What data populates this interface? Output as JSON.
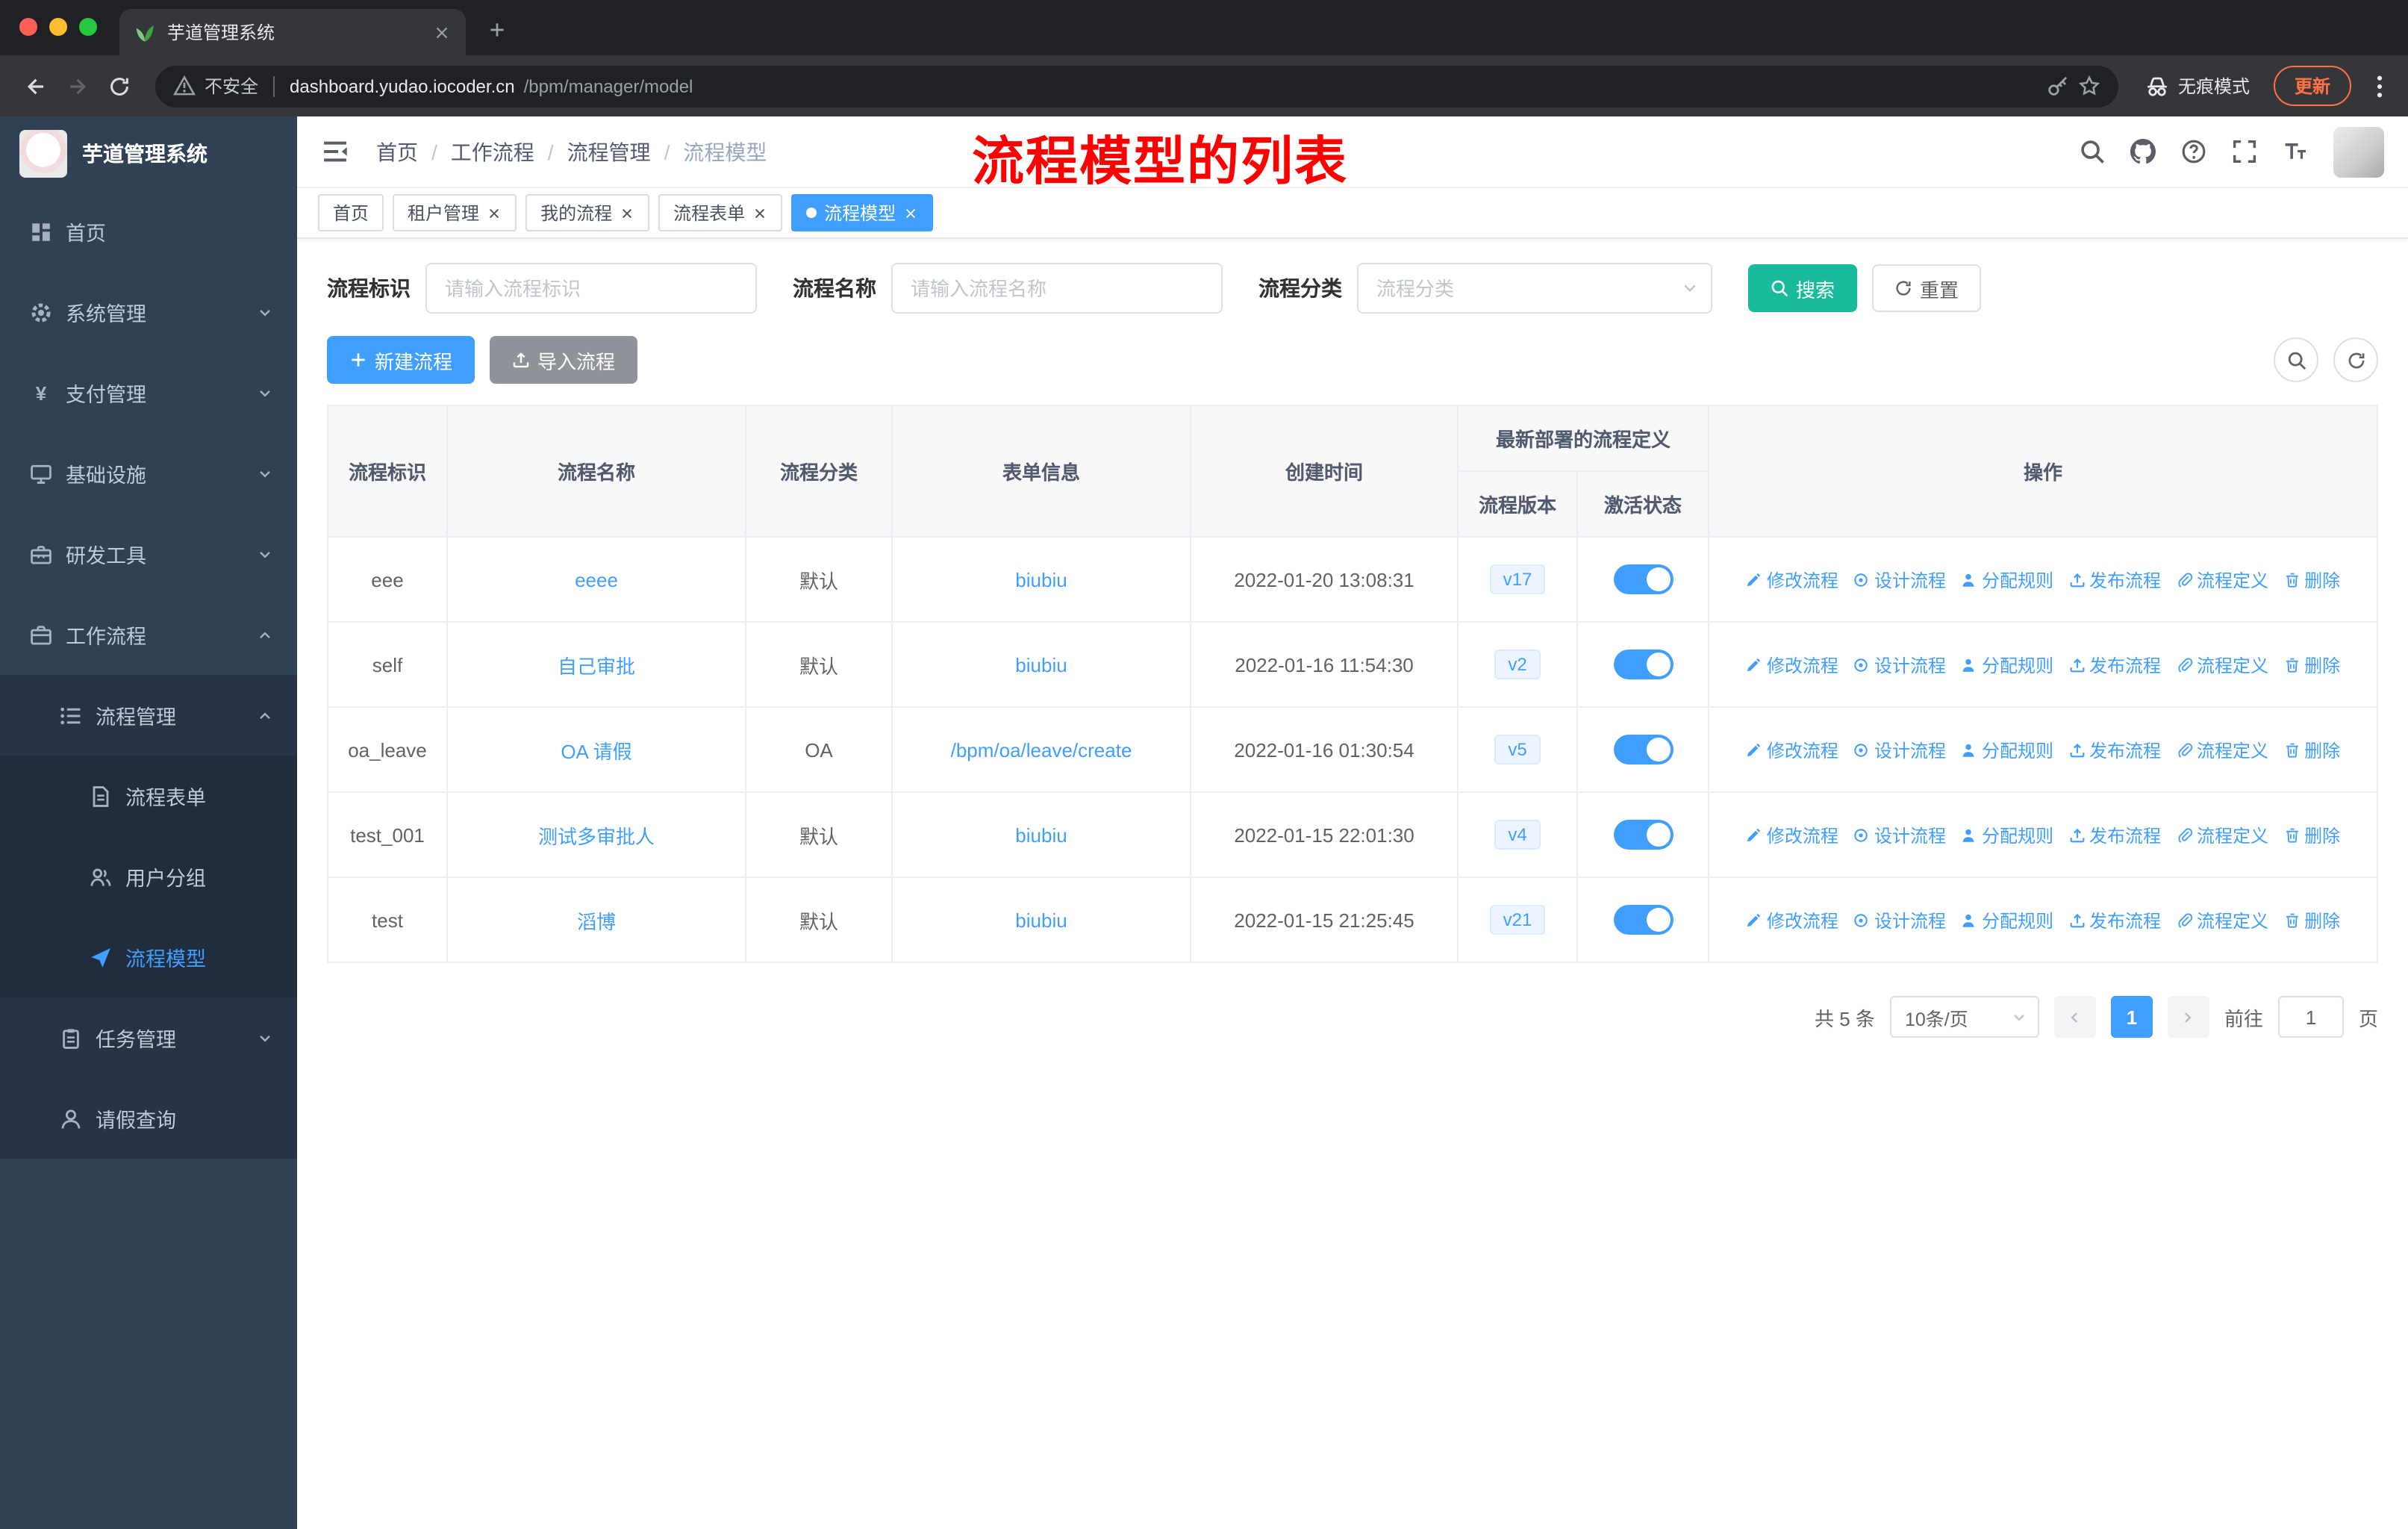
{
  "browser": {
    "tab": {
      "title": "芋道管理系统",
      "favicon": "plant-favicon"
    },
    "toolbar": {
      "security_label": "不安全",
      "url_domain": "dashboard.yudao.iocoder.cn",
      "url_path": "/bpm/manager/model",
      "incognito_label": "无痕模式",
      "update_label": "更新"
    }
  },
  "sidebar": {
    "logo_title": "芋道管理系统",
    "items": [
      {
        "id": "home",
        "label": "首页",
        "icon": "dashboard-icon",
        "depth": 1
      },
      {
        "id": "system",
        "label": "系统管理",
        "icon": "gear-icon",
        "depth": 1,
        "arrow": "down"
      },
      {
        "id": "payment",
        "label": "支付管理",
        "icon": "yen-icon",
        "depth": 1,
        "arrow": "down"
      },
      {
        "id": "infrastructure",
        "label": "基础设施",
        "icon": "monitor-icon",
        "depth": 1,
        "arrow": "down"
      },
      {
        "id": "devtools",
        "label": "研发工具",
        "icon": "toolbox-icon",
        "depth": 1,
        "arrow": "down"
      },
      {
        "id": "workflow",
        "label": "工作流程",
        "icon": "briefcase-icon",
        "depth": 1,
        "arrow": "up"
      },
      {
        "id": "process-management",
        "label": "流程管理",
        "icon": "list-icon",
        "depth": 2,
        "arrow": "up"
      },
      {
        "id": "process-form",
        "label": "流程表单",
        "icon": "document-icon",
        "depth": 3
      },
      {
        "id": "user-group",
        "label": "用户分组",
        "icon": "users-icon",
        "depth": 3
      },
      {
        "id": "process-model",
        "label": "流程模型",
        "icon": "paper-plane-icon",
        "depth": 3,
        "active": true
      },
      {
        "id": "task-management",
        "label": "任务管理",
        "icon": "clipboard-icon",
        "depth": 2,
        "arrow": "down"
      },
      {
        "id": "leave-query",
        "label": "请假查询",
        "icon": "user-icon",
        "depth": 2
      }
    ]
  },
  "navbar": {
    "breadcrumb": [
      "首页",
      "工作流程",
      "流程管理",
      "流程模型"
    ],
    "annotation": "流程模型的列表"
  },
  "tags": [
    {
      "id": "home",
      "label": "首页",
      "closable": false,
      "active": false
    },
    {
      "id": "tenant",
      "label": "租户管理",
      "closable": true,
      "active": false
    },
    {
      "id": "my-process",
      "label": "我的流程",
      "closable": true,
      "active": false
    },
    {
      "id": "process-form",
      "label": "流程表单",
      "closable": true,
      "active": false
    },
    {
      "id": "process-model",
      "label": "流程模型",
      "closable": true,
      "active": true
    }
  ],
  "filters": {
    "key": {
      "label": "流程标识",
      "placeholder": "请输入流程标识",
      "value": ""
    },
    "name": {
      "label": "流程名称",
      "placeholder": "请输入流程名称",
      "value": ""
    },
    "category": {
      "label": "流程分类",
      "placeholder": "流程分类",
      "value": ""
    },
    "search_label": "搜索",
    "reset_label": "重置"
  },
  "toolbar": {
    "create_label": "新建流程",
    "import_label": "导入流程"
  },
  "table": {
    "header": {
      "main": [
        "流程标识",
        "流程名称",
        "流程分类",
        "表单信息",
        "创建时间"
      ],
      "group": {
        "label": "最新部署的流程定义",
        "children": [
          "流程版本",
          "激活状态"
        ]
      },
      "ops": "操作"
    },
    "op_links": [
      {
        "id": "edit",
        "label": "修改流程",
        "icon": "edit-icon"
      },
      {
        "id": "design",
        "label": "设计流程",
        "icon": "design-icon"
      },
      {
        "id": "assign",
        "label": "分配规则",
        "icon": "assign-icon"
      },
      {
        "id": "publish",
        "label": "发布流程",
        "icon": "publish-icon"
      },
      {
        "id": "definition",
        "label": "流程定义",
        "icon": "definition-icon"
      },
      {
        "id": "delete",
        "label": "删除",
        "icon": "delete-icon"
      }
    ],
    "rows": [
      {
        "key": "eee",
        "name": "eeee",
        "category": "默认",
        "form": "biubiu",
        "created": "2022-01-20 13:08:31",
        "version": "v17",
        "active": true
      },
      {
        "key": "self",
        "name": "自己审批",
        "category": "默认",
        "form": "biubiu",
        "created": "2022-01-16 11:54:30",
        "version": "v2",
        "active": true
      },
      {
        "key": "oa_leave",
        "name": "OA 请假",
        "category": "OA",
        "form": "/bpm/oa/leave/create",
        "created": "2022-01-16 01:30:54",
        "version": "v5",
        "active": true
      },
      {
        "key": "test_001",
        "name": "测试多审批人",
        "category": "默认",
        "form": "biubiu",
        "created": "2022-01-15 22:01:30",
        "version": "v4",
        "active": true
      },
      {
        "key": "test",
        "name": "滔博",
        "category": "默认",
        "form": "biubiu",
        "created": "2022-01-15 21:25:45",
        "version": "v21",
        "active": true
      }
    ]
  },
  "pagination": {
    "total_label": "共 5 条",
    "page_size_label": "10条/页",
    "current_page": "1",
    "goto_prefix": "前往",
    "goto_value": "1",
    "goto_suffix": "页"
  },
  "colors": {
    "accent_blue": "#409eff",
    "search_teal": "#18bc9c",
    "annotation_red": "#fe0000",
    "sidebar_bg": "#304156"
  }
}
